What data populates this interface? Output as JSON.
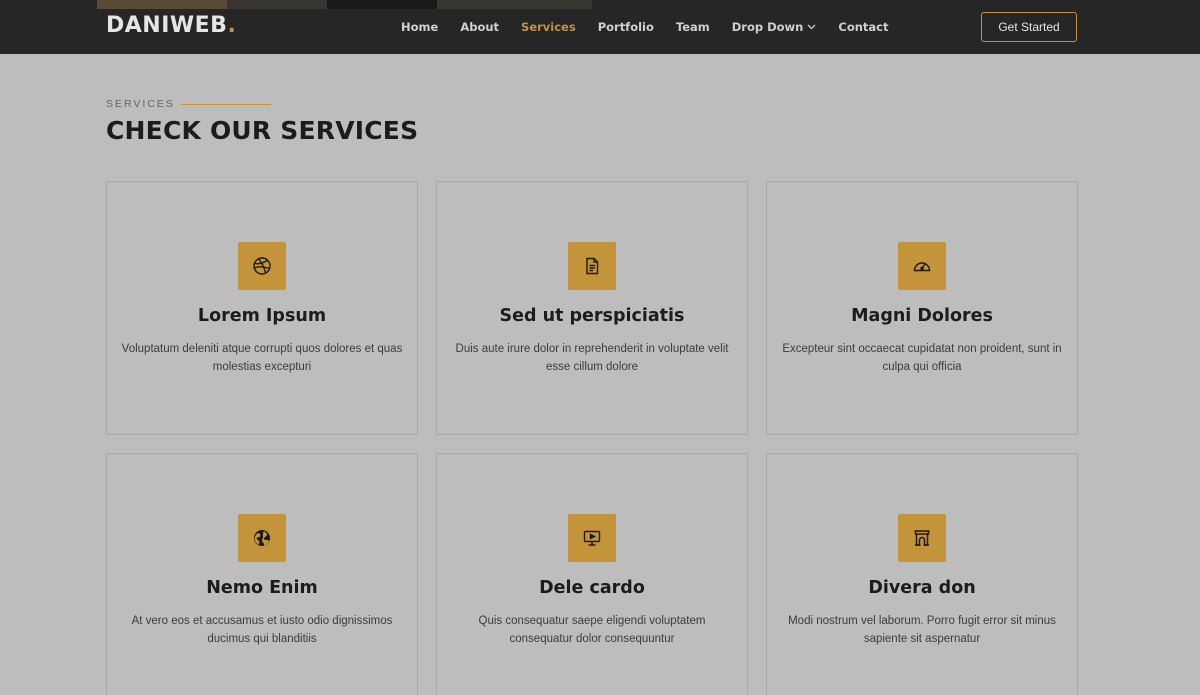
{
  "header": {
    "logo_text": "DANIWEB",
    "logo_dot": ".",
    "nav": [
      {
        "label": "Home"
      },
      {
        "label": "About"
      },
      {
        "label": "Services"
      },
      {
        "label": "Portfolio"
      },
      {
        "label": "Team"
      },
      {
        "label": "Drop Down"
      },
      {
        "label": "Contact"
      }
    ],
    "active_nav": "Services",
    "cta_label": "Get Started"
  },
  "section": {
    "eyebrow": "SERVICES",
    "title": "CHECK OUR SERVICES"
  },
  "services": [
    {
      "icon": "dribbble-icon",
      "title": "Lorem Ipsum",
      "description": "Voluptatum deleniti atque corrupti quos dolores et quas molestias excepturi"
    },
    {
      "icon": "file-text-icon",
      "title": "Sed ut perspiciatis",
      "description": "Duis aute irure dolor in reprehenderit in voluptate velit esse cillum dolore"
    },
    {
      "icon": "speedometer-icon",
      "title": "Magni Dolores",
      "description": "Excepteur sint occaecat cupidatat non proident, sunt in culpa qui officia"
    },
    {
      "icon": "globe-icon",
      "title": "Nemo Enim",
      "description": "At vero eos et accusamus et iusto odio dignissimos ducimus qui blanditiis"
    },
    {
      "icon": "presentation-icon",
      "title": "Dele cardo",
      "description": "Quis consequatur saepe eligendi voluptatem consequatur dolor consequuntur"
    },
    {
      "icon": "archway-icon",
      "title": "Divera don",
      "description": "Modi nostrum vel laborum. Porro fugit error sit minus sapiente sit aspernatur"
    }
  ],
  "colors": {
    "accent": "#c3943a",
    "header_bg": "#262626",
    "page_bg": "#bdbdbd"
  }
}
